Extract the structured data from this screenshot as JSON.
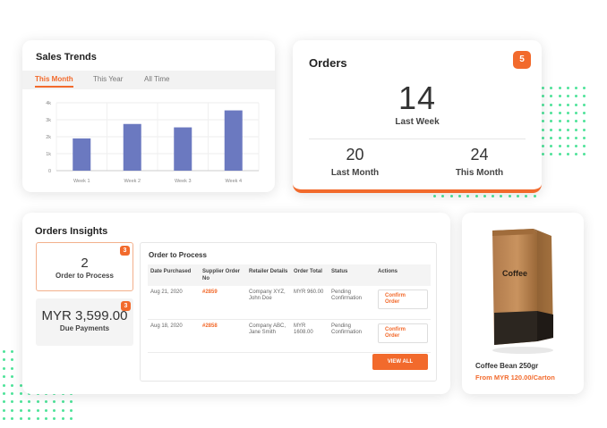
{
  "sales_trends": {
    "title": "Sales Trends",
    "tabs": [
      "This Month",
      "This Year",
      "All Time"
    ],
    "active_tab": 0,
    "chart_data": {
      "type": "bar",
      "categories": [
        "Week 1",
        "Week 2",
        "Week 3",
        "Week 4"
      ],
      "values": [
        1900,
        2750,
        2550,
        3550
      ],
      "yticks": [
        "0",
        "1k",
        "2k",
        "3k",
        "4k"
      ],
      "ylim": [
        0,
        4000
      ],
      "grid": true,
      "colors": {
        "bar": "#6b79c0"
      }
    }
  },
  "orders": {
    "title": "Orders",
    "badge": "5",
    "last_week_value": "14",
    "last_week_label": "Last Week",
    "last_month_value": "20",
    "last_month_label": "Last Month",
    "this_month_value": "24",
    "this_month_label": "This Month"
  },
  "insights": {
    "title": "Orders Insights",
    "stat1": {
      "badge": "3",
      "value": "2",
      "label": "Order to Process"
    },
    "stat2": {
      "badge": "3",
      "value": "MYR 3,599.00",
      "label": "Due Payments"
    },
    "panel_title": "Order to Process",
    "columns": [
      "Date Purchased",
      "Supplier Order No",
      "Retailer Details",
      "Order Total",
      "Status",
      "Actions"
    ],
    "rows": [
      {
        "date": "Aug 21, 2020",
        "supplier": "#2859",
        "retailer": "Company XYZ, John Doe",
        "total": "MYR 960.00",
        "status": "Pending Confirmation",
        "action": "Confirm Order"
      },
      {
        "date": "Aug 18, 2020",
        "supplier": "#2858",
        "retailer": "Company ABC, Jane Smith",
        "total": "MYR 1608.00",
        "status": "Pending Confirmation",
        "action": "Confirm Order"
      }
    ],
    "view_all": "VIEW ALL"
  },
  "product": {
    "bag_text": "Coffee",
    "name": "Coffee Bean 250gr",
    "price": "From MYR 120.00/Carton"
  },
  "colors": {
    "accent": "#f26a2c",
    "bar": "#6b79c0",
    "dots": "#4fe39a"
  }
}
